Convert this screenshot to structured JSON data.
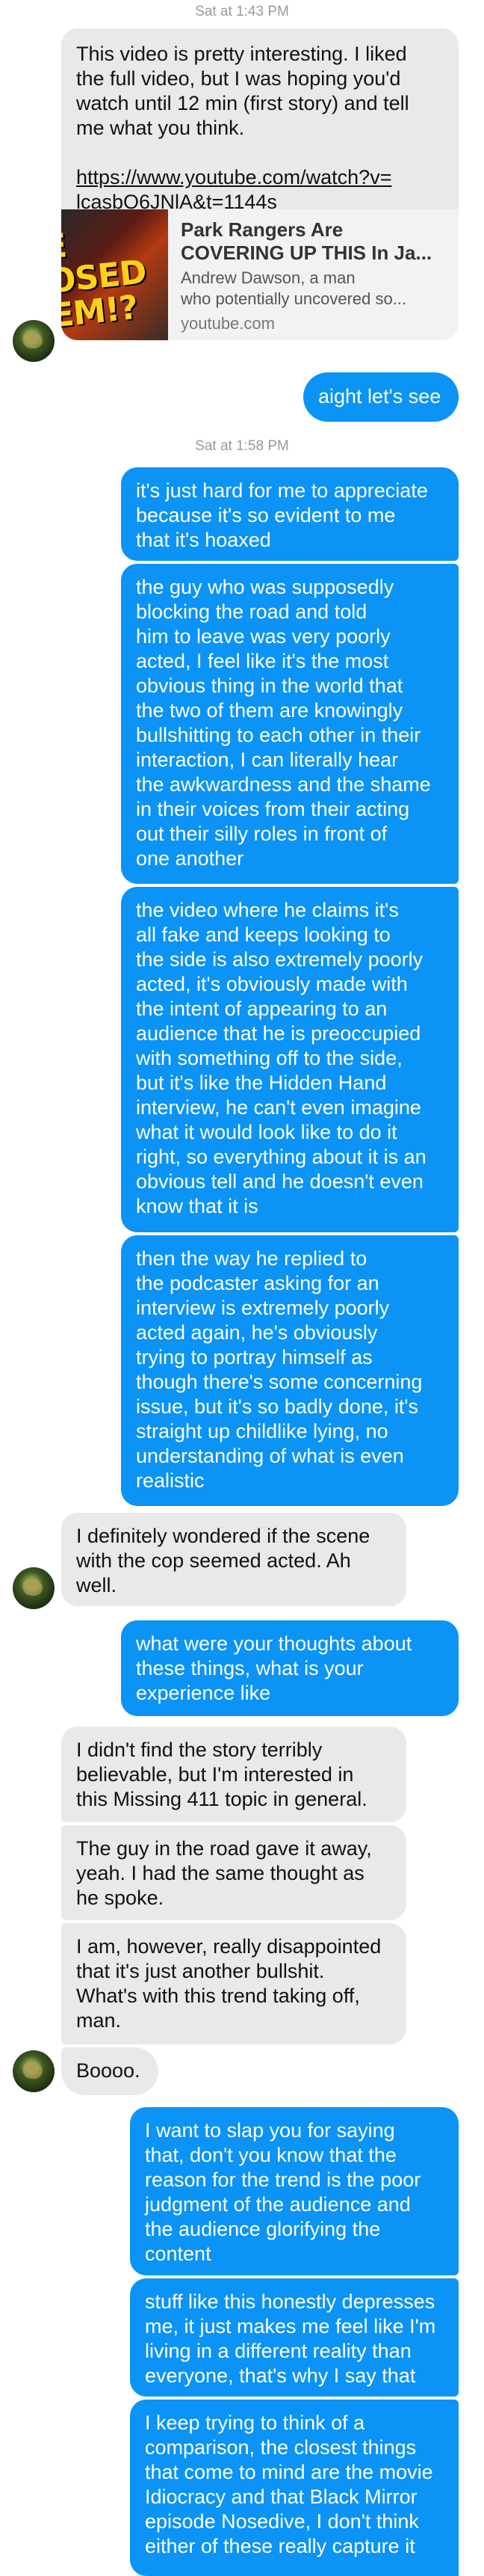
{
  "timestamps": [
    "Sat at 1:43 PM",
    "Sat at 1:58 PM"
  ],
  "colors": {
    "outgoing": "#0b93f6",
    "incoming": "#e9e9eb",
    "timestamp": "#9a9a9a"
  },
  "link_message": {
    "text": "This video is pretty interesting. I liked\nthe full video, but I was hoping you'd\nwatch until 12 min (first story) and tell\nme what you think.",
    "url": "https://www.youtube.com/watch?v=\nlcasbO6JNlA&t=1144s"
  },
  "link_card": {
    "thumbnail_text": "E\nOSED\nEM!?",
    "title": "Park Rangers Are\nCOVERING UP THIS In Ja...",
    "desc_line1": "Andrew Dawson, a man",
    "desc_line2": "who potentially uncovered so...",
    "domain": "youtube.com"
  },
  "messages": [
    {
      "text": "aight let's see"
    },
    {
      "text": "it's just hard for me to appreciate\nbecause it's so evident to me\nthat it's hoaxed"
    },
    {
      "text": "the guy who was supposedly\nblocking the road and told\nhim to leave was very poorly\nacted, I feel like it's the most\nobvious thing in the world that\nthe two of them are knowingly\nbullshitting to each other in their\ninteraction, I can literally hear\nthe awkwardness and the shame\nin their voices from their acting\nout their silly roles in front of\none another"
    },
    {
      "text": "the video where he claims it's\nall fake and keeps looking to\nthe side is also extremely poorly\nacted, it's obviously made with\nthe intent of appearing to an\naudience that he is preoccupied\nwith something off to the side,\nbut it's like the Hidden Hand\ninterview, he can't even imagine\nwhat it would look like to do it\nright, so everything about it is an\nobvious tell and he doesn't even\nknow that it is"
    },
    {
      "text": "then the way he replied to\nthe podcaster asking for an\ninterview is extremely poorly\nacted again, he's obviously\ntrying to portray himself as\nthough there's some concerning\nissue, but it's so badly done, it's\nstraight up childlike lying, no\nunderstanding of what is even\nrealistic"
    },
    {
      "text": "I definitely wondered if the scene\nwith the cop seemed acted. Ah\nwell."
    },
    {
      "text": "what were your thoughts about\nthese things, what is your\nexperience like"
    },
    {
      "text": "I didn't find the story terribly\nbelievable, but I'm interested in\nthis Missing 411 topic in general."
    },
    {
      "text": "The guy in the road gave it away,\nyeah. I had the same thought as\nhe spoke."
    },
    {
      "text": "I am, however, really disappointed\nthat it's just another bullshit.\nWhat's with this trend taking off,\nman."
    },
    {
      "text": "Boooo."
    },
    {
      "text": "I want to slap you for saying\nthat, don't you know that the\nreason for the trend is the poor\njudgment of the audience and\nthe audience glorifying the\ncontent"
    },
    {
      "text": "stuff like this honestly depresses\nme, it just makes me feel like I'm\nliving in a different reality than\neveryone, that's why I say that"
    },
    {
      "text": "I keep trying to think of a\ncomparison, the closest things\nthat come to mind are the movie\nIdiocracy and that Black Mirror\nepisode Nosedive, I don't think\neither of these really capture it"
    }
  ]
}
